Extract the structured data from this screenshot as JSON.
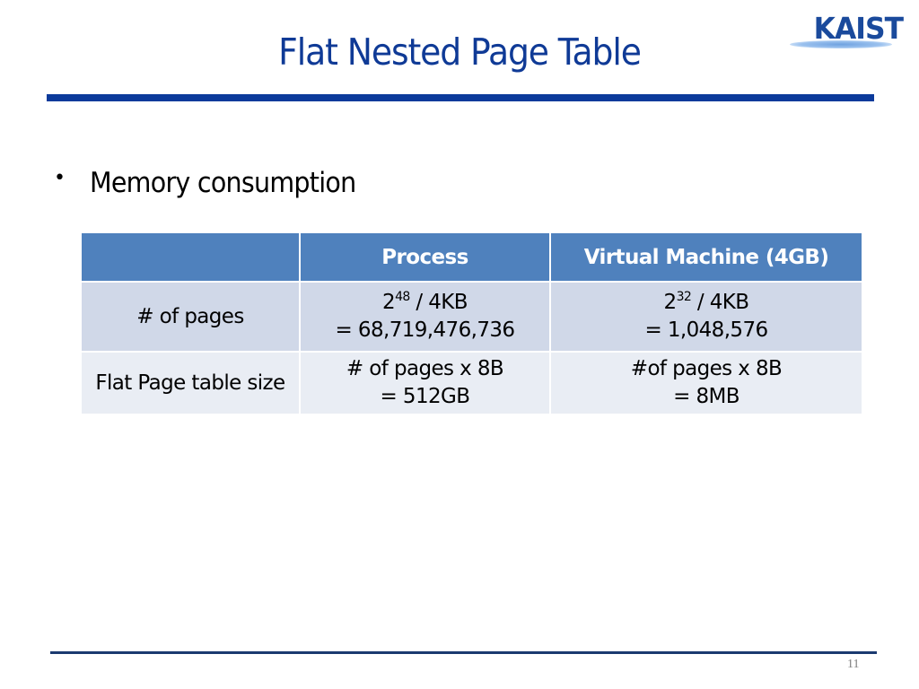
{
  "slide": {
    "title": "Flat Nested Page Table",
    "logo_text": "KAIST",
    "page_number": "11",
    "colors": {
      "title": "#0F3A96",
      "rule": "#0B3A9B",
      "table_header": "#4F81BD",
      "table_row_odd": "#D0D8E8",
      "table_row_even": "#E9EDF4"
    }
  },
  "bullets": [
    {
      "marker": "•",
      "text": "Memory consumption"
    }
  ],
  "table": {
    "headers": [
      "",
      "Process",
      "Virtual Machine (4GB)"
    ],
    "rows": [
      {
        "label": "# of pages",
        "process": {
          "base": "2",
          "exp": "48",
          "suffix": " / 4KB",
          "line2": "= 68,719,476,736"
        },
        "vm": {
          "base": "2",
          "exp": "32",
          "suffix": " / 4KB",
          "line2": "= 1,048,576"
        }
      },
      {
        "label": "Flat Page table size",
        "process": {
          "line1": "# of pages x 8B",
          "line2": "= 512GB"
        },
        "vm": {
          "line1": "#of pages x 8B",
          "line2": "= 8MB"
        }
      }
    ]
  }
}
